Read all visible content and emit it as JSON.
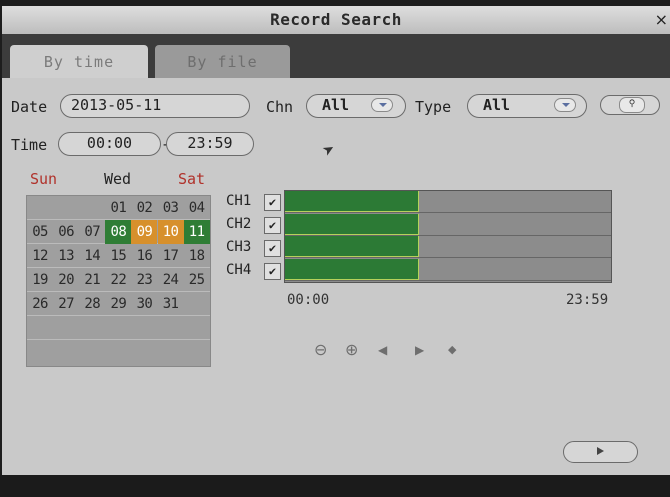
{
  "window": {
    "title": "Record Search",
    "close": "×"
  },
  "tabs": [
    {
      "label": "By time"
    },
    {
      "label": "By file"
    }
  ],
  "filters": {
    "date_label": "Date",
    "date_value": "2013-05-11",
    "chn_label": "Chn",
    "chn_value": "All",
    "type_label": "Type",
    "type_value": "All",
    "time_label": "Time",
    "time_from": "00:00",
    "time_sep": "-",
    "time_to": "23:59"
  },
  "calendar": {
    "headers": [
      "Sun",
      "Wed",
      "Sat"
    ],
    "header_colors": [
      "#b0312a",
      "#222222",
      "#b0312a"
    ],
    "rows": [
      [
        "",
        "",
        "",
        "01",
        "02",
        "03",
        "04"
      ],
      [
        "05",
        "06",
        "07",
        "08",
        "09",
        "10",
        "11"
      ],
      [
        "12",
        "13",
        "14",
        "15",
        "16",
        "17",
        "18"
      ],
      [
        "19",
        "20",
        "21",
        "22",
        "23",
        "24",
        "25"
      ],
      [
        "26",
        "27",
        "28",
        "29",
        "30",
        "31",
        ""
      ],
      [
        "",
        "",
        "",
        "",
        "",
        "",
        ""
      ]
    ],
    "recorded_days": [
      "08",
      "11"
    ],
    "selected_days": [
      "09",
      "10"
    ],
    "colors": {
      "recorded_bg": "#2f7d35",
      "recorded_fg": "#ffffff",
      "selected_bg": "#d7902c",
      "selected_fg": "#ffffff"
    }
  },
  "channels": [
    {
      "label": "CH1",
      "checked": true,
      "check": "✔",
      "recorded_fraction": 0.41
    },
    {
      "label": "CH2",
      "checked": true,
      "check": "✔",
      "recorded_fraction": 0.41
    },
    {
      "label": "CH3",
      "checked": true,
      "check": "✔",
      "recorded_fraction": 0.41
    },
    {
      "label": "CH4",
      "checked": true,
      "check": "✔",
      "recorded_fraction": 0.41
    }
  ],
  "timeline": {
    "start": "00:00",
    "end": "23:59"
  },
  "controls": [
    {
      "icon": "zoom-out-icon",
      "glyph": "⊖"
    },
    {
      "icon": "zoom-in-icon",
      "glyph": "⊕"
    },
    {
      "icon": "prev-icon",
      "glyph": "◀"
    },
    {
      "icon": "next-icon",
      "glyph": "▶"
    },
    {
      "icon": "locate-icon",
      "glyph": "◆"
    }
  ],
  "icons": {
    "search": "search-icon",
    "play": "play-icon",
    "dropdown": "chevron-down-icon"
  }
}
